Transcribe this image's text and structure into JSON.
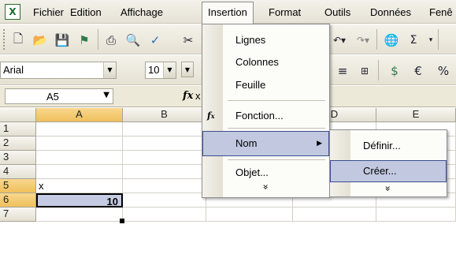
{
  "menubar": {
    "items": [
      "Fichier",
      "Edition",
      "Affichage",
      "Insertion",
      "Format",
      "Outils",
      "Données",
      "Fenê"
    ]
  },
  "toolbar": {
    "font_name": "Arial",
    "font_size": "10"
  },
  "formula_bar": {
    "name_box": "A5",
    "fx_label": "fx",
    "content": "x"
  },
  "grid": {
    "columns": [
      "A",
      "B",
      "C",
      "D",
      "E"
    ],
    "rows": [
      "1",
      "2",
      "3",
      "4",
      "5",
      "6",
      "7"
    ],
    "cells": {
      "A5": "x",
      "A6": "10"
    }
  },
  "insert_menu": {
    "items": [
      "Lignes",
      "Colonnes",
      "Feuille",
      "Fonction...",
      "Nom",
      "Objet...",
      "»"
    ],
    "expand": "»"
  },
  "name_submenu": {
    "items": [
      "Définir...",
      "Créer..."
    ],
    "expand": "»"
  },
  "colors": {
    "menu_highlight": "#c1c8e0",
    "menu_highlight_border": "#3b4e8c",
    "selected_header": "#efc05c",
    "selected_cell": "#c5cbe3"
  }
}
